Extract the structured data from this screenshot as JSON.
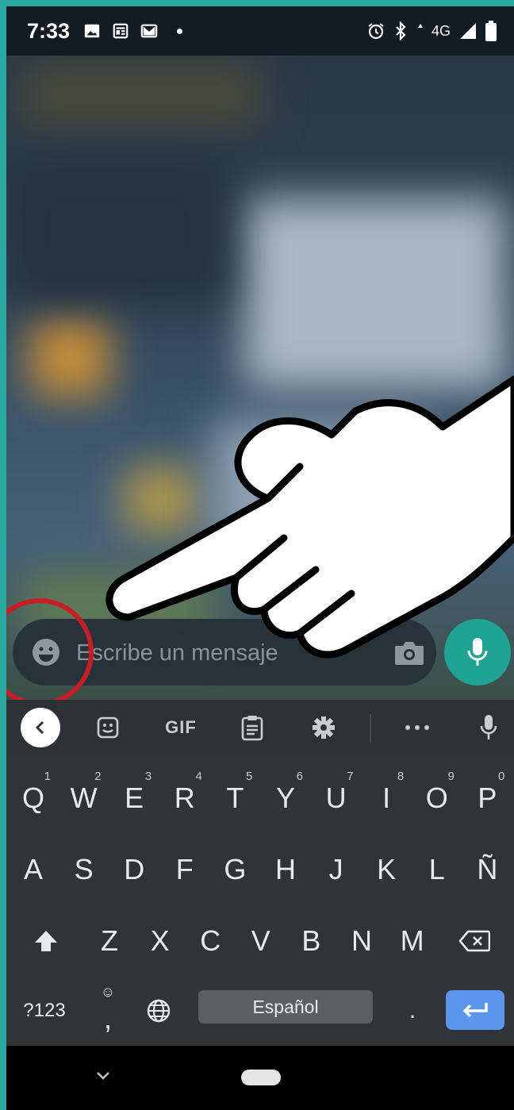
{
  "status_bar": {
    "time": "7:33",
    "network": "4G"
  },
  "message_bar": {
    "placeholder": "Escribe un mensaje"
  },
  "keyboard": {
    "toolbar": {
      "gif_label": "GIF"
    },
    "row1": [
      {
        "key": "Q",
        "hint": "1"
      },
      {
        "key": "W",
        "hint": "2"
      },
      {
        "key": "E",
        "hint": "3"
      },
      {
        "key": "R",
        "hint": "4"
      },
      {
        "key": "T",
        "hint": "5"
      },
      {
        "key": "Y",
        "hint": "6"
      },
      {
        "key": "U",
        "hint": "7"
      },
      {
        "key": "I",
        "hint": "8"
      },
      {
        "key": "O",
        "hint": "9"
      },
      {
        "key": "P",
        "hint": "0"
      }
    ],
    "row2": [
      "A",
      "S",
      "D",
      "F",
      "G",
      "H",
      "J",
      "K",
      "L",
      "Ñ"
    ],
    "row3": [
      "Z",
      "X",
      "C",
      "V",
      "B",
      "N",
      "M"
    ],
    "symbols_key": "?123",
    "comma_key": ",",
    "period_key": ".",
    "space_label": "Español"
  },
  "colors": {
    "accent": "#1fa494",
    "highlight": "#c81d25",
    "enter": "#5b95ec"
  }
}
